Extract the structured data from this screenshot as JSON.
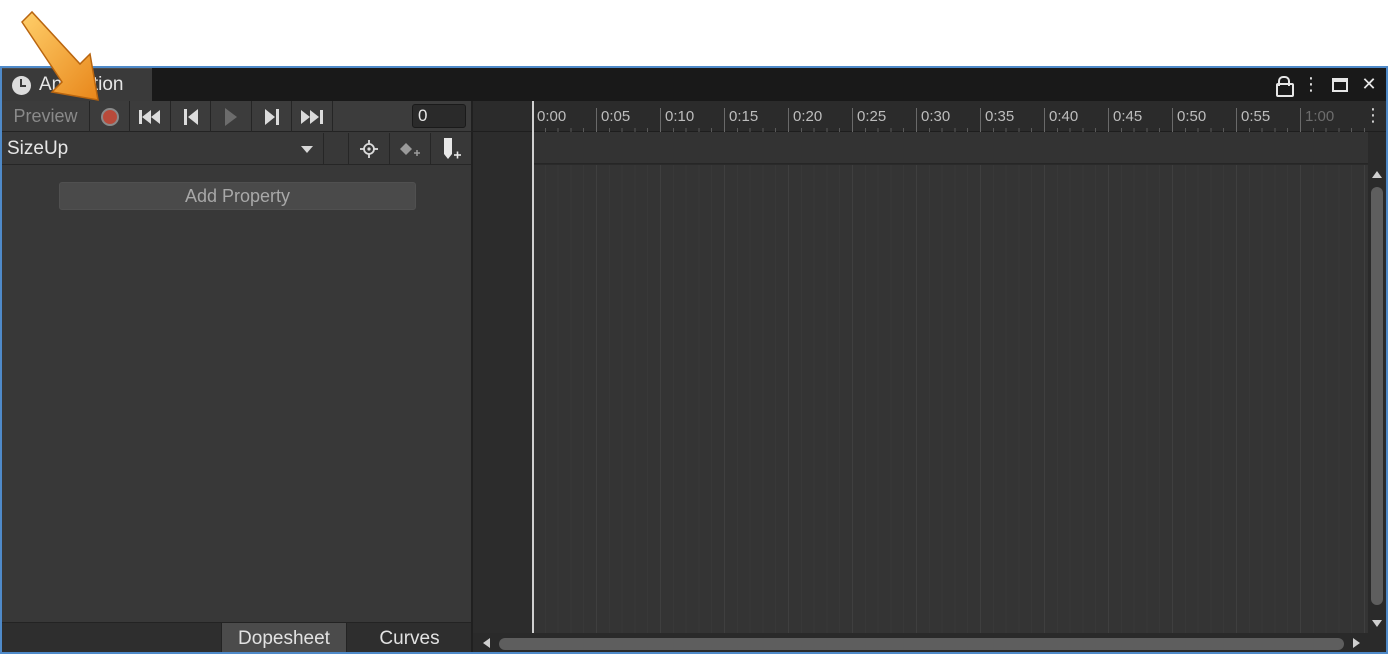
{
  "window": {
    "tab_title": "Animation",
    "controls": [
      "lock-icon",
      "kebab-menu-icon",
      "maximize-icon",
      "close-icon"
    ]
  },
  "toolbar": {
    "preview_label": "Preview",
    "frame_value": "0",
    "record_color": "#b84a3a",
    "buttons": [
      "record-icon",
      "first-key-icon",
      "prev-key-icon",
      "play-icon",
      "next-key-icon",
      "last-key-icon"
    ]
  },
  "clip": {
    "selected": "SizeUp",
    "actions": [
      "filter-by-selection-icon",
      "add-keyframe-icon",
      "add-event-icon"
    ]
  },
  "properties": {
    "add_property_label": "Add Property"
  },
  "timeline": {
    "ticks": [
      "0:00",
      "0:05",
      "0:10",
      "0:15",
      "0:20",
      "0:25",
      "0:30",
      "0:35",
      "0:40",
      "0:45",
      "0:50",
      "0:55",
      "1:00"
    ]
  },
  "bottom_tabs": {
    "dopesheet": "Dopesheet",
    "curves": "Curves",
    "active": "Dopesheet"
  },
  "annotation": {
    "arrow_color": "#f0a030"
  }
}
